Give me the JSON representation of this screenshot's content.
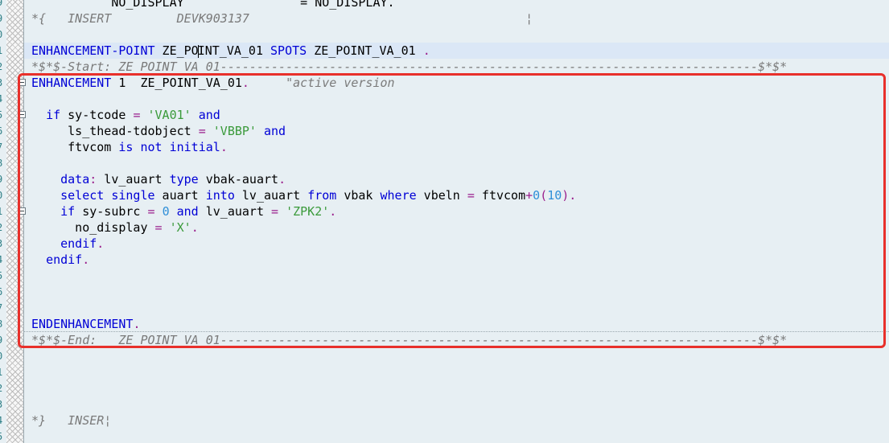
{
  "gutter_digits": [
    "9",
    "9",
    "0",
    "1",
    "2",
    "3",
    "4",
    "5",
    "6",
    "7",
    "8",
    "9",
    "0",
    "1",
    "2",
    "3",
    "4",
    "5",
    "6",
    "7",
    "8",
    "9",
    "0",
    "1",
    "2",
    "3",
    "4",
    "5"
  ],
  "lines": [
    {
      "segments": [
        {
          "t": "           NO_DISPLAY                = NO_DISPLAY.",
          "c": ""
        }
      ]
    },
    {
      "segments": [
        {
          "t": "*{   INSERT         DEVK903137                                      ¦",
          "c": "cmt"
        }
      ]
    },
    {
      "segments": [
        {
          "t": "",
          "c": ""
        }
      ]
    },
    {
      "hl": true,
      "segments": [
        {
          "t": "ENHANCEMENT-POINT",
          "c": "kw"
        },
        {
          "t": " ZE_PO",
          "c": ""
        },
        {
          "cursor": true
        },
        {
          "t": "INT_VA_01 ",
          "c": ""
        },
        {
          "t": "SPOTS",
          "c": "kw"
        },
        {
          "t": " ZE_POINT_VA_01 ",
          "c": ""
        },
        {
          "t": ".",
          "c": "op"
        }
      ]
    },
    {
      "segments": [
        {
          "t": "*$*$-Start: ZE_POINT_VA_01--------------------------------------------------------------------------$*$*",
          "c": "cmt"
        }
      ]
    },
    {
      "fold": true,
      "segments": [
        {
          "t": "ENHANCEMENT",
          "c": "kw"
        },
        {
          "t": " 1  ZE_POINT_VA_01",
          "c": ""
        },
        {
          "t": ".",
          "c": "op"
        },
        {
          "t": "     ",
          "c": ""
        },
        {
          "t": "\"active version",
          "c": "cmt"
        }
      ]
    },
    {
      "segments": [
        {
          "t": "",
          "c": ""
        }
      ]
    },
    {
      "fold": true,
      "segments": [
        {
          "t": "  ",
          "c": ""
        },
        {
          "t": "if",
          "c": "kw"
        },
        {
          "t": " sy-tcode ",
          "c": ""
        },
        {
          "t": "=",
          "c": "op"
        },
        {
          "t": " ",
          "c": ""
        },
        {
          "t": "'VA01'",
          "c": "str"
        },
        {
          "t": " ",
          "c": ""
        },
        {
          "t": "and",
          "c": "kw"
        }
      ]
    },
    {
      "segments": [
        {
          "t": "     ls_thead-tdobject ",
          "c": ""
        },
        {
          "t": "=",
          "c": "op"
        },
        {
          "t": " ",
          "c": ""
        },
        {
          "t": "'VBBP'",
          "c": "str"
        },
        {
          "t": " ",
          "c": ""
        },
        {
          "t": "and",
          "c": "kw"
        }
      ]
    },
    {
      "segments": [
        {
          "t": "     ftvcom ",
          "c": ""
        },
        {
          "t": "is not initial",
          "c": "kw"
        },
        {
          "t": ".",
          "c": "op"
        }
      ]
    },
    {
      "segments": [
        {
          "t": "",
          "c": ""
        }
      ]
    },
    {
      "segments": [
        {
          "t": "    ",
          "c": ""
        },
        {
          "t": "data",
          "c": "kw"
        },
        {
          "t": ":",
          "c": "op"
        },
        {
          "t": " lv_auart ",
          "c": ""
        },
        {
          "t": "type",
          "c": "kw"
        },
        {
          "t": " vbak-auart",
          "c": ""
        },
        {
          "t": ".",
          "c": "op"
        }
      ]
    },
    {
      "segments": [
        {
          "t": "    ",
          "c": ""
        },
        {
          "t": "select single",
          "c": "kw"
        },
        {
          "t": " auart ",
          "c": ""
        },
        {
          "t": "into",
          "c": "kw"
        },
        {
          "t": " lv_auart ",
          "c": ""
        },
        {
          "t": "from",
          "c": "kw"
        },
        {
          "t": " vbak ",
          "c": ""
        },
        {
          "t": "where",
          "c": "kw"
        },
        {
          "t": " vbeln ",
          "c": ""
        },
        {
          "t": "=",
          "c": "op"
        },
        {
          "t": " ftvcom",
          "c": ""
        },
        {
          "t": "+",
          "c": "op"
        },
        {
          "t": "0",
          "c": "num"
        },
        {
          "t": "(",
          "c": "op"
        },
        {
          "t": "10",
          "c": "num"
        },
        {
          "t": ").",
          "c": "op"
        }
      ]
    },
    {
      "fold": true,
      "segments": [
        {
          "t": "    ",
          "c": ""
        },
        {
          "t": "if",
          "c": "kw"
        },
        {
          "t": " sy-subrc ",
          "c": ""
        },
        {
          "t": "=",
          "c": "op"
        },
        {
          "t": " ",
          "c": ""
        },
        {
          "t": "0",
          "c": "num"
        },
        {
          "t": " ",
          "c": ""
        },
        {
          "t": "and",
          "c": "kw"
        },
        {
          "t": " lv_auart ",
          "c": ""
        },
        {
          "t": "=",
          "c": "op"
        },
        {
          "t": " ",
          "c": ""
        },
        {
          "t": "'ZPK2'",
          "c": "str"
        },
        {
          "t": ".",
          "c": "op"
        }
      ]
    },
    {
      "segments": [
        {
          "t": "      no_display ",
          "c": ""
        },
        {
          "t": "=",
          "c": "op"
        },
        {
          "t": " ",
          "c": ""
        },
        {
          "t": "'X'",
          "c": "str"
        },
        {
          "t": ".",
          "c": "op"
        }
      ]
    },
    {
      "segments": [
        {
          "t": "    ",
          "c": ""
        },
        {
          "t": "endif",
          "c": "kw"
        },
        {
          "t": ".",
          "c": "op"
        }
      ]
    },
    {
      "segments": [
        {
          "t": "  ",
          "c": ""
        },
        {
          "t": "endif",
          "c": "kw"
        },
        {
          "t": ".",
          "c": "op"
        }
      ]
    },
    {
      "segments": [
        {
          "t": "",
          "c": ""
        }
      ]
    },
    {
      "segments": [
        {
          "t": "",
          "c": ""
        }
      ]
    },
    {
      "segments": [
        {
          "t": "",
          "c": ""
        }
      ]
    },
    {
      "dotted": true,
      "segments": [
        {
          "t": "ENDENHANCEMENT",
          "c": "kw"
        },
        {
          "t": ".",
          "c": "op"
        }
      ]
    },
    {
      "segments": [
        {
          "t": "*$*$-End:   ZE_POINT_VA_01--------------------------------------------------------------------------$*$*",
          "c": "cmt"
        }
      ]
    },
    {
      "segments": [
        {
          "t": "",
          "c": ""
        }
      ]
    },
    {
      "segments": [
        {
          "t": "",
          "c": ""
        }
      ]
    },
    {
      "segments": [
        {
          "t": "",
          "c": ""
        }
      ]
    },
    {
      "segments": [
        {
          "t": "",
          "c": ""
        }
      ]
    },
    {
      "segments": [
        {
          "t": "*}   INSER¦",
          "c": "cmt"
        }
      ]
    },
    {
      "segments": [
        {
          "t": "",
          "c": ""
        }
      ]
    }
  ],
  "colors": {
    "keyword": "#0000d6",
    "string": "#3a9a3a",
    "number": "#2f8fd8",
    "operator": "#9a1e8c",
    "comment": "#7a7a7a",
    "highlight_border": "#e8302b",
    "background": "#e7eff3"
  }
}
